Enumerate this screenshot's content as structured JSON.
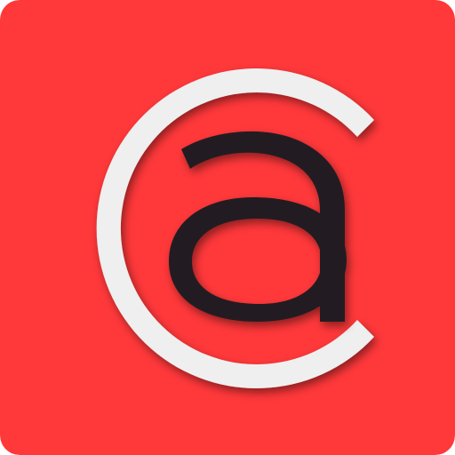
{
  "icon": {
    "name": "ca-logo-app-icon",
    "logo_lettering": "ca",
    "colors": {
      "background": "#ff383a",
      "outer_letter_c": "#efefef",
      "inner_letter_a": "#231f20"
    }
  }
}
